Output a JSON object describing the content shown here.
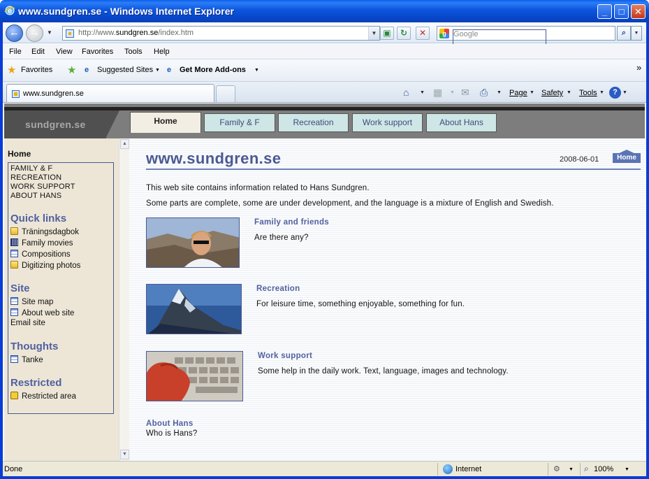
{
  "window": {
    "title": "www.sundgren.se - Windows Internet Explorer"
  },
  "nav": {
    "address_prefix": "http://www.",
    "address_host": "sundgren.se",
    "address_path": "/index.htm",
    "search_placeholder": "Google",
    "search_button_icon": "magnifier-icon"
  },
  "menu": [
    "File",
    "Edit",
    "View",
    "Favorites",
    "Tools",
    "Help"
  ],
  "favorites_bar": {
    "favorites_label": "Favorites",
    "suggested_label": "Suggested Sites",
    "addons_label": "Get More Add-ons",
    "chevron": "»"
  },
  "tabs": {
    "active_tab": "www.sundgren.se"
  },
  "command_bar": {
    "page": "Page",
    "safety": "Safety",
    "tools": "Tools",
    "help": "?"
  },
  "site": {
    "logo": "sundgren.se",
    "tabs": [
      "Home",
      "Family & F",
      "Recreation",
      "Work support",
      "About Hans"
    ],
    "active_tab_index": 0
  },
  "sidebar": {
    "home": "Home",
    "top_links": [
      "FAMILY & F",
      "RECREATION",
      "WORK SUPPORT",
      "ABOUT HANS"
    ],
    "quick_links_heading": "Quick links",
    "quick_links": [
      "Träningsdagbok",
      "Family movies",
      "Compositions",
      "Digitizing photos"
    ],
    "site_heading": "Site",
    "site_links": [
      "Site map",
      "About web site",
      "Email site"
    ],
    "thoughts_heading": "Thoughts",
    "thoughts_links": [
      "Tanke"
    ],
    "restricted_heading": "Restricted",
    "restricted_links": [
      "Restricted area"
    ]
  },
  "content": {
    "title": "www.sundgren.se",
    "date": "2008-06-01",
    "home_badge": "Home",
    "intro1": "This web site contains information related to Hans Sundgren.",
    "intro2": "Some parts are complete, some are under development, and the language is a mixture of English and Swedish.",
    "sections": [
      {
        "heading": "Family and friends",
        "text": "Are there any?"
      },
      {
        "heading": "Recreation",
        "text": "For leisure time, something enjoyable, something for fun."
      },
      {
        "heading": "Work support",
        "text": "Some help in the daily work. Text, language, images and technology."
      },
      {
        "heading": "About Hans",
        "text": "Who is Hans?"
      }
    ]
  },
  "status": {
    "left": "Done",
    "zone": "Internet",
    "zoom": "100%"
  }
}
